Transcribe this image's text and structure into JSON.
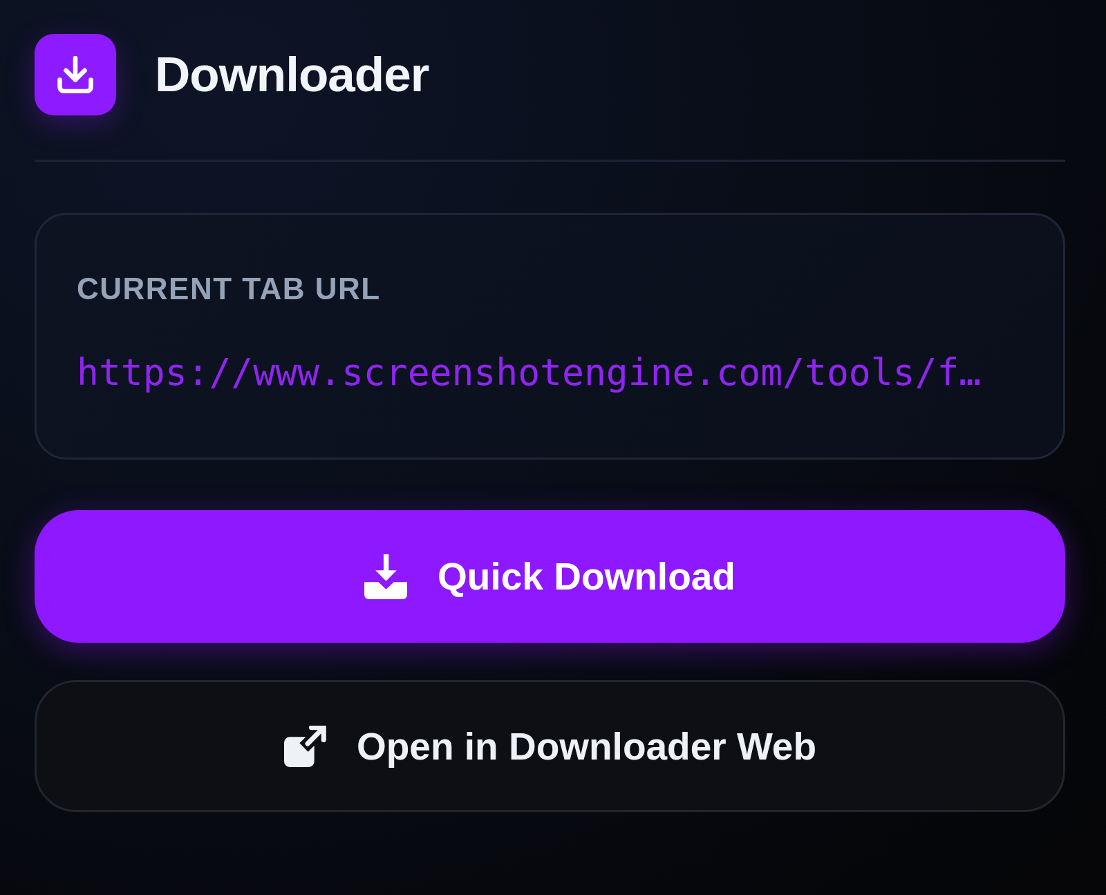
{
  "header": {
    "title": "Downloader"
  },
  "url_card": {
    "label": "CURRENT TAB URL",
    "url": "https://www.screenshotengine.com/tools/f…"
  },
  "buttons": [
    {
      "kind": "primary",
      "label": "Quick Download"
    },
    {
      "kind": "secondary",
      "label": "Open in Downloader Web"
    }
  ]
}
